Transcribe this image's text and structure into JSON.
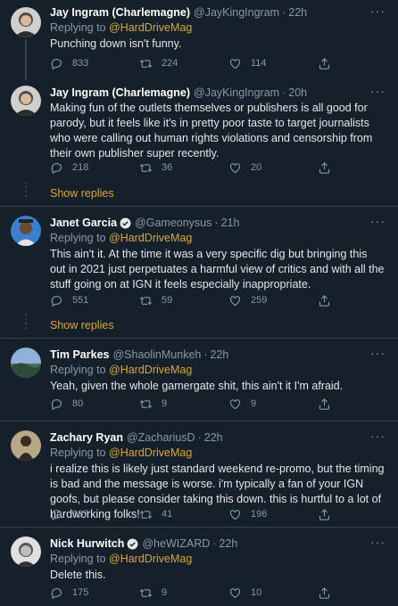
{
  "tweets": [
    {
      "name": "Jay Ingram (Charlemagne)",
      "handle": "@JayKingIngram",
      "time": "22h",
      "reply_prefix": "Replying to ",
      "reply_to": "@HardDriveMag",
      "text": "Punching down isn't funny.",
      "replies": "833",
      "retweets": "224",
      "likes": "114"
    },
    {
      "name": "Jay Ingram (Charlemagne)",
      "handle": "@JayKingIngram",
      "time": "20h",
      "text": "Making fun of the outlets themselves or publishers is all good for parody, but it feels like it's in pretty poor taste to target journalists who were calling out human rights violations and censorship from their own publisher super recently.",
      "replies": "218",
      "retweets": "36",
      "likes": "20",
      "show_replies": "Show replies"
    },
    {
      "name": "Janet Garcia",
      "handle": "@Gameonysus",
      "time": "21h",
      "reply_prefix": "Replying to ",
      "reply_to": "@HardDriveMag",
      "text": "This ain't it. At the time it was a very specific dig but bringing this out in 2021 just perpetuates a harmful view of critics and with all the stuff going on at IGN it feels especially inappropriate.",
      "replies": "551",
      "retweets": "59",
      "likes": "259",
      "show_replies": "Show replies"
    },
    {
      "name": "Tim Parkes",
      "handle": "@ShaolinMunkeh",
      "time": "22h",
      "reply_prefix": "Replying to ",
      "reply_to": "@HardDriveMag",
      "text": "Yeah, given the whole gamergate shit, this ain't it I'm afraid.",
      "replies": "80",
      "retweets": "9",
      "likes": "9"
    },
    {
      "name": "Zachary Ryan",
      "handle": "@ZachariusD",
      "time": "22h",
      "reply_prefix": "Replying to ",
      "reply_to": "@HardDriveMag",
      "text": "i realize this is likely just standard weekend re-promo, but the timing is bad and the message is worse. i'm typically a fan of your IGN goofs, but please consider taking this down. this is hurtful to a lot of hardworking folks!",
      "replies": "367",
      "retweets": "41",
      "likes": "196"
    },
    {
      "name": "Nick Hurwitch",
      "handle": "@heWIZARD",
      "time": "22h",
      "reply_prefix": "Replying to ",
      "reply_to": "@HardDriveMag",
      "text": "Delete this.",
      "replies": "175",
      "retweets": "9",
      "likes": "10"
    }
  ],
  "symbols": {
    "sep": "·",
    "more": "···"
  },
  "colors": {
    "background": "#15202b",
    "accent": "#d9a63a",
    "muted": "#8899a6",
    "verified": "#1da1f2"
  },
  "icons": [
    "reply-icon",
    "retweet-icon",
    "like-icon",
    "share-icon",
    "verified-badge-icon",
    "more-icon"
  ]
}
